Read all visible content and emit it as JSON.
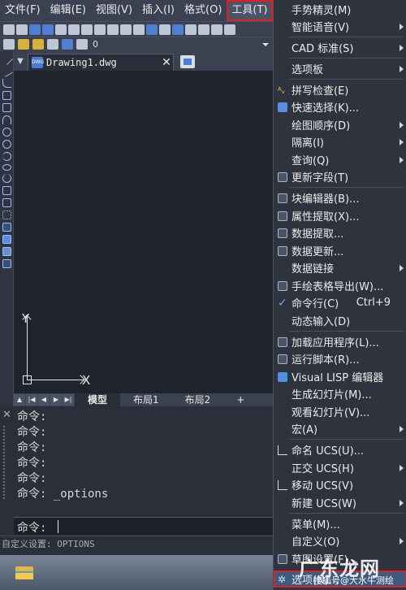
{
  "menubar": {
    "items": [
      "文件(F)",
      "编辑(E)",
      "视图(V)",
      "插入(I)",
      "格式(O)",
      "工具(T)"
    ]
  },
  "toolbar2": {
    "layer_value": "0"
  },
  "document": {
    "tab_name": "Drawing1.dwg",
    "icon_text": "DWG",
    "close_glyph": "✕"
  },
  "canvas": {
    "axis_y": "Y",
    "axis_x": "X"
  },
  "layout_tabs": {
    "tabs": [
      "模型",
      "布局1",
      "布局2",
      "+"
    ]
  },
  "command": {
    "history": [
      "命令:",
      "命令:",
      "命令:",
      "命令:",
      "命令:",
      "命令: _options"
    ],
    "prompt": "命令:",
    "close_glyph": "✕"
  },
  "statusbar": {
    "text": "自定义设置: OPTIONS"
  },
  "tools_menu": {
    "items": [
      {
        "label": "手势精灵(M)",
        "sub": false
      },
      {
        "label": "智能语音(V)",
        "sub": true
      },
      {
        "label": "CAD 标准(S)",
        "sub": true
      },
      {
        "label": "选项板",
        "sub": true
      },
      {
        "label": "拼写检查(E)",
        "sub": false
      },
      {
        "label": "快速选择(K)...",
        "sub": false
      },
      {
        "label": "绘图顺序(D)",
        "sub": true
      },
      {
        "label": "隔离(I)",
        "sub": true
      },
      {
        "label": "查询(Q)",
        "sub": true
      },
      {
        "label": "更新字段(T)",
        "sub": false
      },
      {
        "label": "块编辑器(B)...",
        "sub": false
      },
      {
        "label": "属性提取(X)...",
        "sub": false
      },
      {
        "label": "数据提取...",
        "sub": false
      },
      {
        "label": "数据更新...",
        "sub": false
      },
      {
        "label": "数据链接",
        "sub": true
      },
      {
        "label": "手绘表格导出(W)...",
        "sub": false
      },
      {
        "label": "命令行(C)",
        "shortcut": "Ctrl+9",
        "sub": false
      },
      {
        "label": "动态输入(D)",
        "sub": false
      },
      {
        "label": "加载应用程序(L)...",
        "sub": false
      },
      {
        "label": "运行脚本(R)...",
        "sub": false
      },
      {
        "label": "Visual LISP 编辑器",
        "sub": false
      },
      {
        "label": "生成幻灯片(M)...",
        "sub": false
      },
      {
        "label": "观看幻灯片(V)...",
        "sub": false
      },
      {
        "label": "宏(A)",
        "sub": true
      },
      {
        "label": "命名 UCS(U)...",
        "sub": false
      },
      {
        "label": "正交 UCS(H)",
        "sub": true
      },
      {
        "label": "移动 UCS(V)",
        "sub": false
      },
      {
        "label": "新建 UCS(W)",
        "sub": true
      },
      {
        "label": "菜单(M)...",
        "sub": false
      },
      {
        "label": "自定义(O)",
        "sub": true
      },
      {
        "label": "草图设置(F)...",
        "sub": false
      },
      {
        "label": "选项(N)...",
        "sub": false
      }
    ]
  },
  "watermark": {
    "main": "广东龙网",
    "sub": "搜狐号@大水牛测绘"
  }
}
